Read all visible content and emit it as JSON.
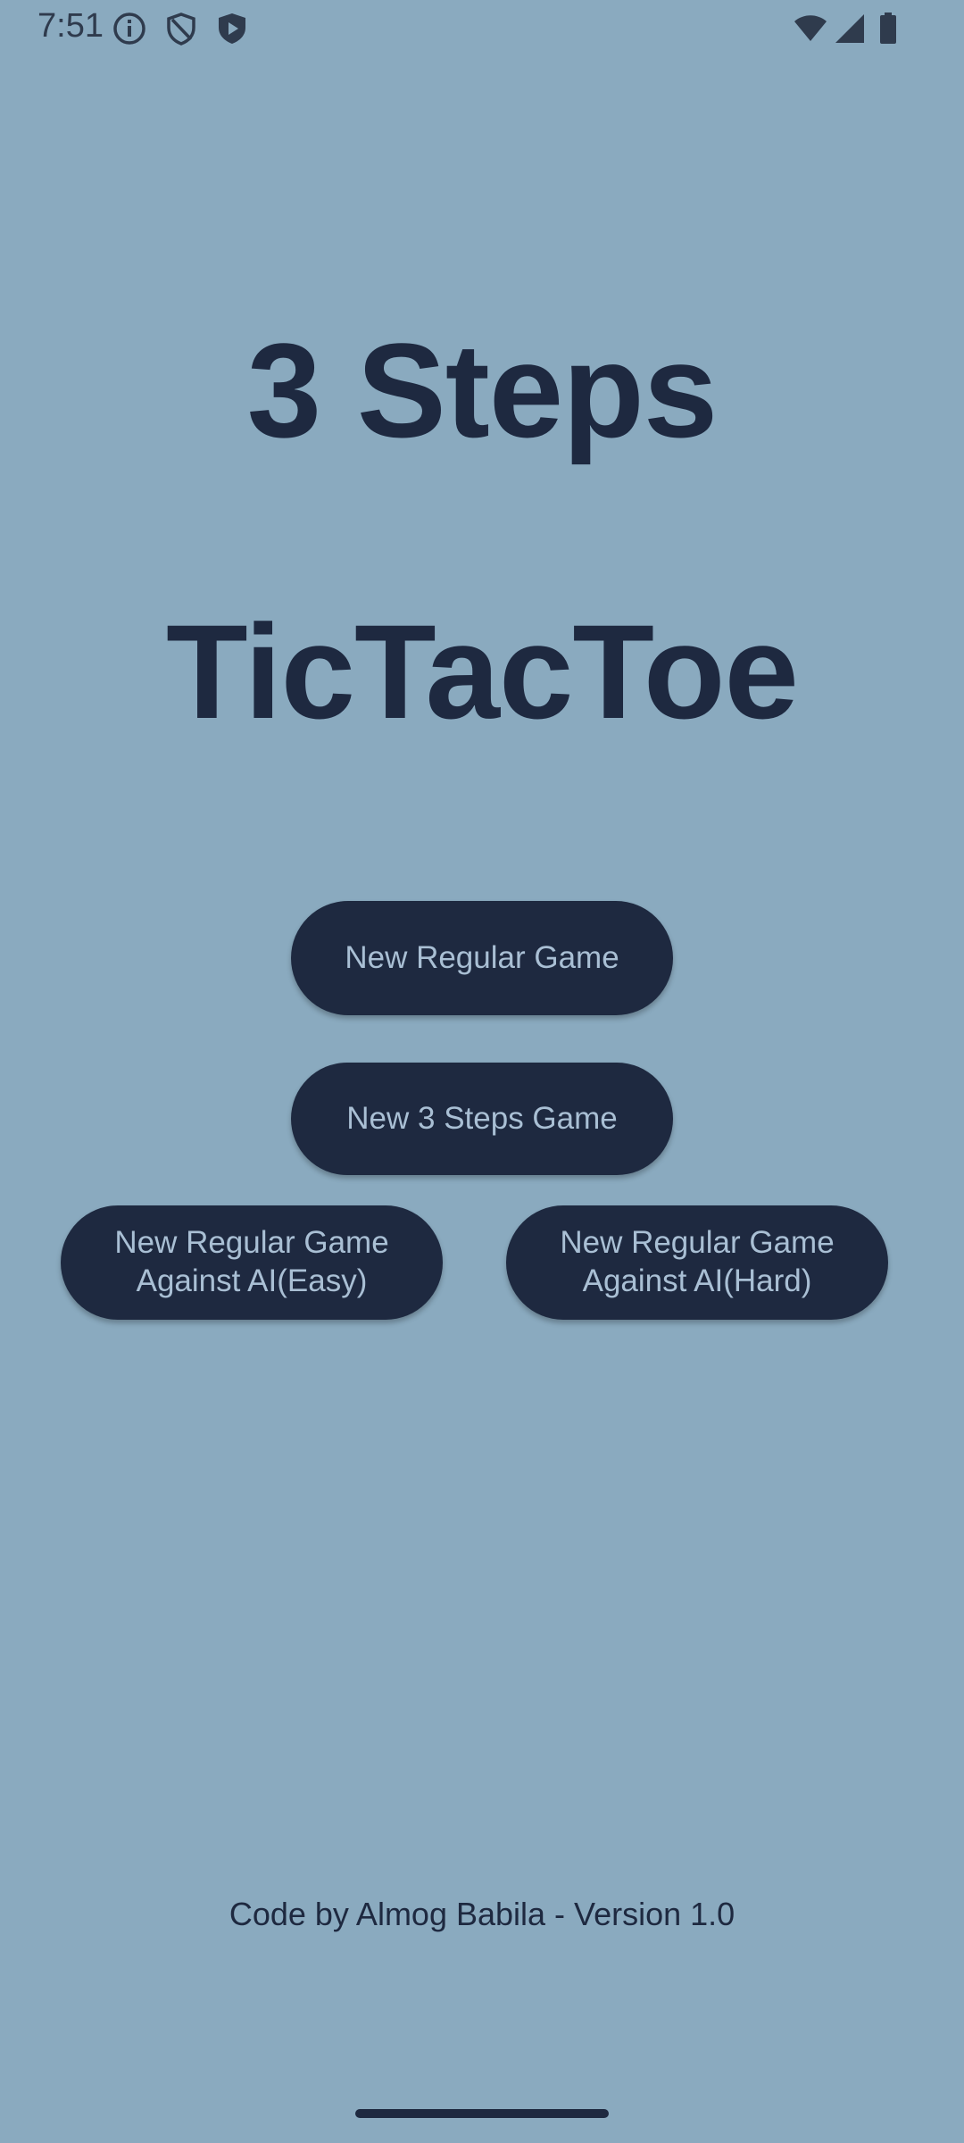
{
  "status_bar": {
    "time": "7:51",
    "left_icons": [
      "info-icon",
      "shield-icon",
      "play-shield-icon"
    ],
    "right_icons": [
      "wifi-icon",
      "cellular-signal-icon",
      "battery-icon"
    ]
  },
  "title": {
    "line1": "3 Steps",
    "line2": "TicTacToe"
  },
  "buttons": {
    "new_regular_game": "New Regular Game",
    "new_3_steps_game": "New 3 Steps Game",
    "ai_easy": "New Regular Game\nAgainst AI(Easy)",
    "ai_hard": "New Regular Game\nAgainst AI(Hard)"
  },
  "footer": {
    "credit": "Code by Almog Babila - Version 1.0"
  },
  "colors": {
    "background": "#8AAABF",
    "primary_dark": "#1E2940",
    "button_text": "#A9BFD4"
  }
}
